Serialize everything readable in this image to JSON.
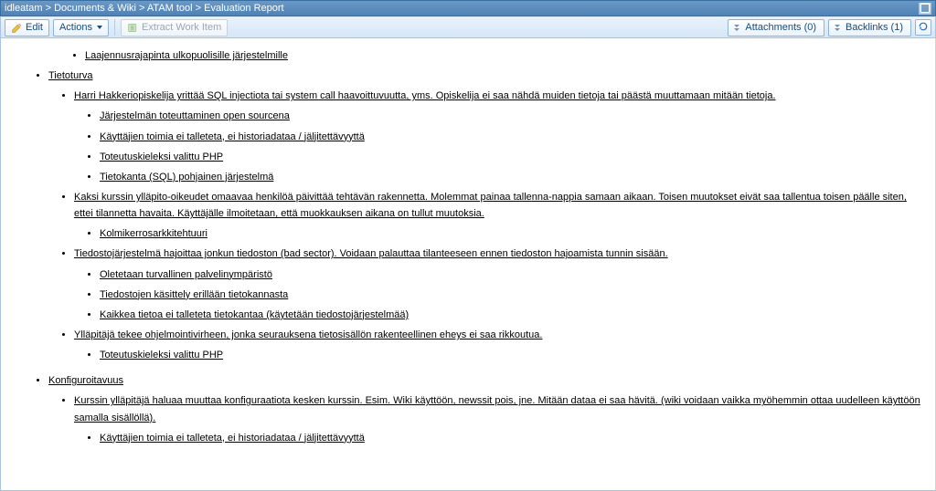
{
  "breadcrumb": "idleatam > Documents & Wiki > ATAM tool > Evaluation Report",
  "toolbar": {
    "edit": "Edit",
    "actions": "Actions",
    "extract": "Extract Work Item",
    "attachments": "Attachments  (0)",
    "backlinks": "Backlinks  (1)"
  },
  "orphan0": "Laajennusrajapinta ulkopuolisille järjestelmille",
  "sections": [
    {
      "heading": "Tietoturva",
      "children": [
        {
          "text": "Harri Hakkeriopiskelija yrittää SQL injectiota tai system call haavoittuvuutta, yms. Opiskelija ei saa nähdä muiden tietoja tai päästä muuttamaan mitään tietoja.",
          "children": [
            {
              "text": "Järjestelmän toteuttaminen open sourcena"
            },
            {
              "text": "Käyttäjien toimia ei talleteta, ei historiadataa / jäljitettävyyttä"
            },
            {
              "text": "Toteutuskieleksi valittu PHP"
            },
            {
              "text": "Tietokanta (SQL) pohjainen järjestelmä"
            }
          ]
        },
        {
          "text": "Kaksi kurssin ylläpito-oikeudet omaavaa henkilöä päivittää tehtävän rakennetta. Molemmat painaa tallenna-nappia samaan aikaan. Toisen muutokset eivät saa tallentua toisen päälle siten, ettei tilannetta havaita. Käyttäjälle ilmoitetaan, että muokkauksen aikana on tullut muutoksia.",
          "children": [
            {
              "text": "Kolmikerrosarkkitehtuuri"
            }
          ]
        },
        {
          "text": "Tiedostojärjestelmä hajoittaa jonkun tiedoston (bad sector). Voidaan palauttaa tilanteeseen ennen tiedoston hajoamista tunnin sisään.",
          "children": [
            {
              "text": "Oletetaan turvallinen palvelinympäristö"
            },
            {
              "text": "Tiedostojen käsittely erillään tietokannasta"
            },
            {
              "text": "Kaikkea tietoa ei talleteta tietokantaa (käytetään tiedostojärjestelmää)"
            }
          ]
        },
        {
          "text": "Ylläpitäjä tekee ohjelmointivirheen, jonka seurauksena tietosisällön rakenteellinen eheys ei saa rikkoutua.",
          "children": [
            {
              "text": "Toteutuskieleksi valittu PHP"
            }
          ]
        }
      ]
    },
    {
      "heading": "Konfiguroitavuus",
      "children": [
        {
          "text": "Kurssin ylläpitäjä haluaa muuttaa konfiguraatiota kesken kurssin. Esim. Wiki käyttöön, newssit pois, jne. Mitään dataa ei saa hävitä. (wiki voidaan vaikka myöhemmin ottaa uudelleen käyttöön samalla sisällöllä).",
          "children": [
            {
              "text": "Käyttäjien toimia ei talleteta, ei historiadataa / jäljitettävyyttä"
            }
          ]
        }
      ]
    }
  ]
}
